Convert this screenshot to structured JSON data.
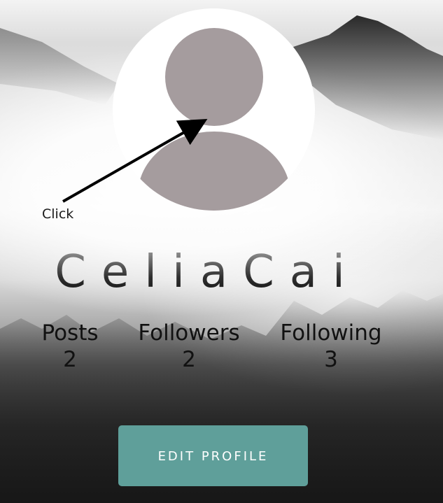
{
  "annotation": {
    "label": "Click"
  },
  "profile": {
    "username": "CeliaCai",
    "avatar_icon": "default-user-avatar-icon"
  },
  "stats": {
    "posts": {
      "label": "Posts",
      "value": "2"
    },
    "followers": {
      "label": "Followers",
      "value": "2"
    },
    "following": {
      "label": "Following",
      "value": "3"
    }
  },
  "actions": {
    "edit_profile_label": "EDIT PROFILE"
  },
  "colors": {
    "button_bg": "#5f9f9a",
    "avatar_fill": "#a59c9e",
    "avatar_bg": "#ffffff"
  }
}
